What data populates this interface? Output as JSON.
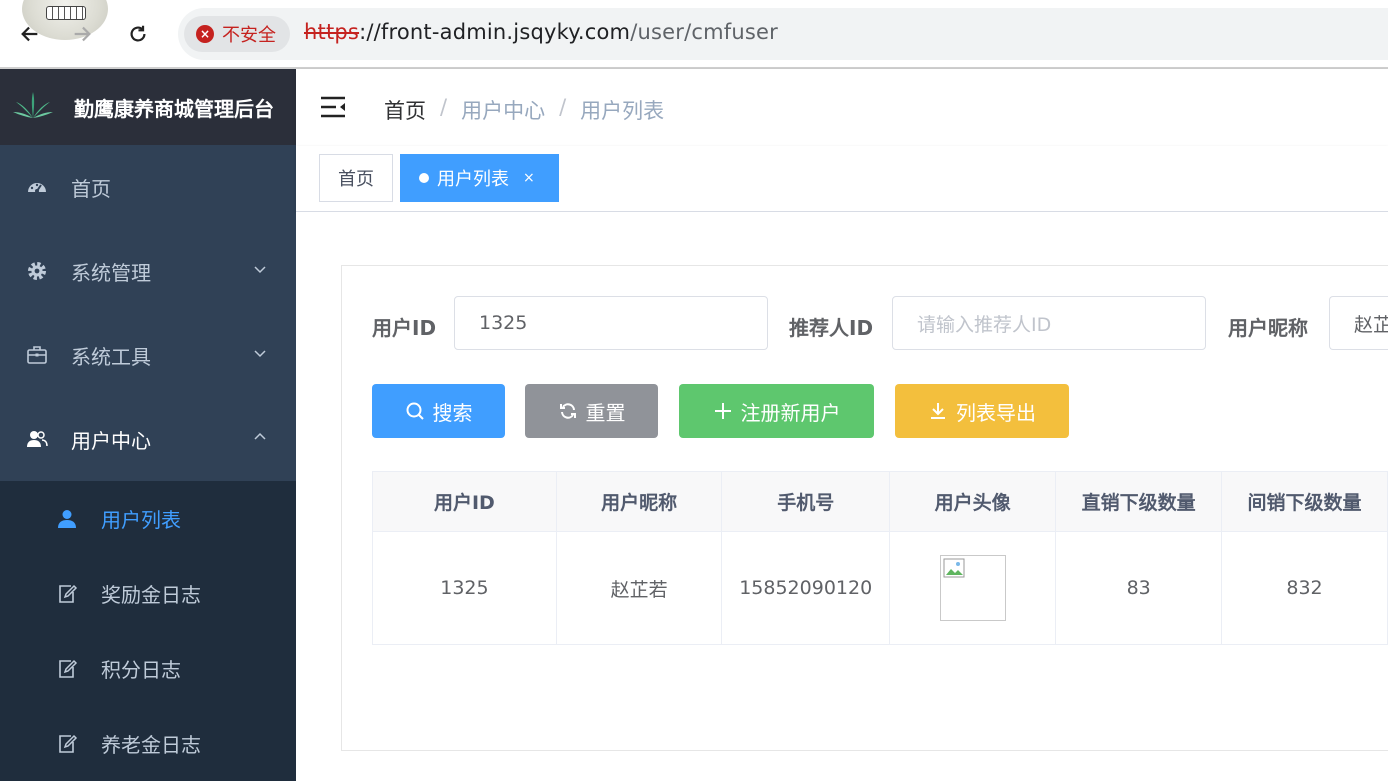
{
  "browser": {
    "security_label": "不安全",
    "url_scheme": "https",
    "url_host": "://front-admin.jsqyky.com",
    "url_path": "/user/cmfuser"
  },
  "sidebar": {
    "brand_title": "勤鹰康养商城管理后台",
    "items": [
      {
        "label": "首页",
        "icon": "dashboard-icon"
      },
      {
        "label": "系统管理",
        "icon": "gear-icon"
      },
      {
        "label": "系统工具",
        "icon": "toolbox-icon"
      },
      {
        "label": "用户中心",
        "icon": "users-icon"
      }
    ],
    "sub_items": [
      {
        "label": "用户列表",
        "icon": "user-icon",
        "active": true
      },
      {
        "label": "奖励金日志",
        "icon": "edit-icon"
      },
      {
        "label": "积分日志",
        "icon": "edit-icon"
      },
      {
        "label": "养老金日志",
        "icon": "edit-icon"
      }
    ],
    "colors": {
      "bg": "#304156",
      "submenu_bg": "#1f2d3d",
      "active": "#409eff"
    }
  },
  "header": {
    "breadcrumb": [
      "首页",
      "用户中心",
      "用户列表"
    ],
    "breadcrumb_sep": "/"
  },
  "tags": [
    {
      "label": "首页",
      "active": false
    },
    {
      "label": "用户列表",
      "active": true,
      "close": "×"
    }
  ],
  "filters": {
    "user_id_label": "用户ID",
    "user_id_value": "1325",
    "referrer_label": "推荐人ID",
    "referrer_placeholder": "请输入推荐人ID",
    "nickname_label": "用户昵称",
    "nickname_value": "赵芷"
  },
  "buttons": {
    "search": "搜索",
    "reset": "重置",
    "register": "注册新用户",
    "export": "列表导出"
  },
  "table": {
    "columns": [
      "用户ID",
      "用户昵称",
      "手机号",
      "用户头像",
      "直销下级数量",
      "间销下级数量"
    ],
    "rows": [
      {
        "id": "1325",
        "nickname": "赵芷若",
        "phone": "15852090120",
        "direct": "83",
        "indirect": "832"
      }
    ]
  }
}
